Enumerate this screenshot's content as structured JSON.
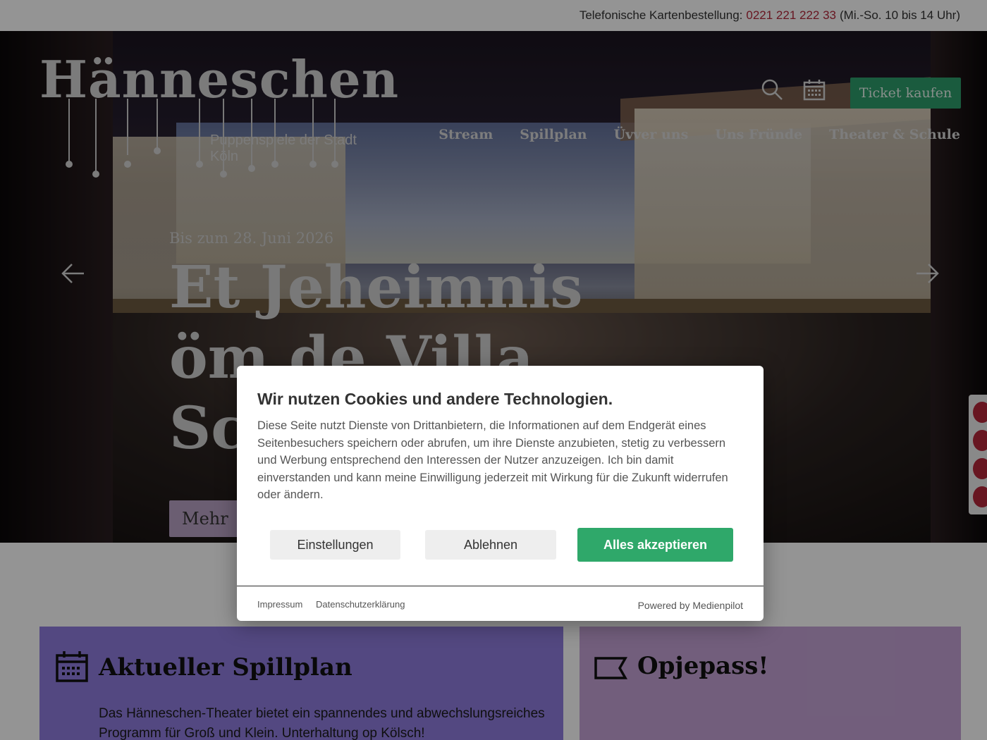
{
  "topbar": {
    "label": "Telefonische Kartenbestellung:",
    "phone": "0221 221 222 33",
    "hours": "(Mi.-So. 10 bis 14 Uhr)"
  },
  "logo": {
    "wordmark": "Hänneschen",
    "subtitle": "Puppenspiele der Stadt Köln"
  },
  "header": {
    "ticket_button": "Ticket kaufen",
    "icons": [
      "search-icon",
      "calendar-icon"
    ]
  },
  "nav": {
    "items": [
      "Stream",
      "Spillplan",
      "Üvver uns",
      "Uns Fründe",
      "Theater & Schule"
    ]
  },
  "hero": {
    "date": "Bis zum 28. Juni 2026",
    "title": "Et Jeheimnis öm de Villa Sc",
    "more_button": "Mehr"
  },
  "cards": {
    "left": {
      "title": "Aktueller Spillplan",
      "text": "Das Hänneschen-Theater bietet ein spannendes und abwechslungsreiches Programm für Groß und Klein. Unterhaltung op Kölsch!"
    },
    "right": {
      "title": "Opjepass!"
    }
  },
  "cookie": {
    "title": "Wir nutzen Cookies und andere Technologien.",
    "text": "Diese Seite nutzt Dienste von Drittanbietern, die Informationen auf dem Endgerät eines Seitenbesuchers speichern oder abrufen, um ihre Dienste anzubieten, stetig zu verbessern und Werbung entsprechend den Interessen der Nutzer anzuzeigen. Ich bin damit einverstanden und kann meine Einwilligung jederzeit mit Wirkung für die Zukunft widerrufen oder ändern.",
    "settings_button": "Einstellungen",
    "decline_button": "Ablehnen",
    "accept_button": "Alles akzeptieren",
    "imprint_link": "Impressum",
    "privacy_link": "Datenschutzerklärung",
    "powered_by": "Powered by Medienpilot"
  },
  "colors": {
    "accent_green": "#2e9e6b",
    "phone_red": "#b3263a",
    "card_violet": "#8f7cde",
    "card_lilac": "#c5a3d6"
  }
}
